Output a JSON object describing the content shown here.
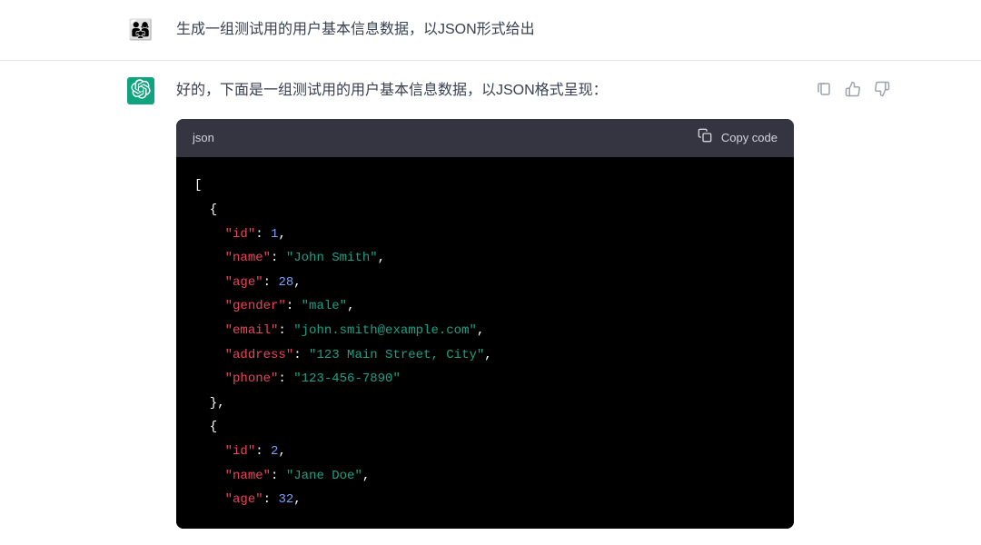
{
  "user": {
    "message": "生成一组测试用的用户基本信息数据，以JSON形式给出"
  },
  "assistant": {
    "intro": "好的，下面是一组测试用的用户基本信息数据，以JSON格式呈现：",
    "code": {
      "language": "json",
      "copy_label": "Copy code",
      "tokens": [
        [
          {
            "t": "brace",
            "v": "["
          }
        ],
        [
          {
            "t": "brace",
            "v": "  {"
          }
        ],
        [
          {
            "t": "plain",
            "v": "    "
          },
          {
            "t": "key",
            "v": "\"id\""
          },
          {
            "t": "punct",
            "v": ": "
          },
          {
            "t": "num",
            "v": "1"
          },
          {
            "t": "punct",
            "v": ","
          }
        ],
        [
          {
            "t": "plain",
            "v": "    "
          },
          {
            "t": "key",
            "v": "\"name\""
          },
          {
            "t": "punct",
            "v": ": "
          },
          {
            "t": "str",
            "v": "\"John Smith\""
          },
          {
            "t": "punct",
            "v": ","
          }
        ],
        [
          {
            "t": "plain",
            "v": "    "
          },
          {
            "t": "key",
            "v": "\"age\""
          },
          {
            "t": "punct",
            "v": ": "
          },
          {
            "t": "num",
            "v": "28"
          },
          {
            "t": "punct",
            "v": ","
          }
        ],
        [
          {
            "t": "plain",
            "v": "    "
          },
          {
            "t": "key",
            "v": "\"gender\""
          },
          {
            "t": "punct",
            "v": ": "
          },
          {
            "t": "str",
            "v": "\"male\""
          },
          {
            "t": "punct",
            "v": ","
          }
        ],
        [
          {
            "t": "plain",
            "v": "    "
          },
          {
            "t": "key",
            "v": "\"email\""
          },
          {
            "t": "punct",
            "v": ": "
          },
          {
            "t": "str",
            "v": "\"john.smith@example.com\""
          },
          {
            "t": "punct",
            "v": ","
          }
        ],
        [
          {
            "t": "plain",
            "v": "    "
          },
          {
            "t": "key",
            "v": "\"address\""
          },
          {
            "t": "punct",
            "v": ": "
          },
          {
            "t": "str",
            "v": "\"123 Main Street, City\""
          },
          {
            "t": "punct",
            "v": ","
          }
        ],
        [
          {
            "t": "plain",
            "v": "    "
          },
          {
            "t": "key",
            "v": "\"phone\""
          },
          {
            "t": "punct",
            "v": ": "
          },
          {
            "t": "str",
            "v": "\"123-456-7890\""
          }
        ],
        [
          {
            "t": "brace",
            "v": "  },"
          }
        ],
        [
          {
            "t": "brace",
            "v": "  {"
          }
        ],
        [
          {
            "t": "plain",
            "v": "    "
          },
          {
            "t": "key",
            "v": "\"id\""
          },
          {
            "t": "punct",
            "v": ": "
          },
          {
            "t": "num",
            "v": "2"
          },
          {
            "t": "punct",
            "v": ","
          }
        ],
        [
          {
            "t": "plain",
            "v": "    "
          },
          {
            "t": "key",
            "v": "\"name\""
          },
          {
            "t": "punct",
            "v": ": "
          },
          {
            "t": "str",
            "v": "\"Jane Doe\""
          },
          {
            "t": "punct",
            "v": ","
          }
        ],
        [
          {
            "t": "plain",
            "v": "    "
          },
          {
            "t": "key",
            "v": "\"age\""
          },
          {
            "t": "punct",
            "v": ": "
          },
          {
            "t": "num",
            "v": "32"
          },
          {
            "t": "punct",
            "v": ","
          }
        ]
      ]
    }
  }
}
